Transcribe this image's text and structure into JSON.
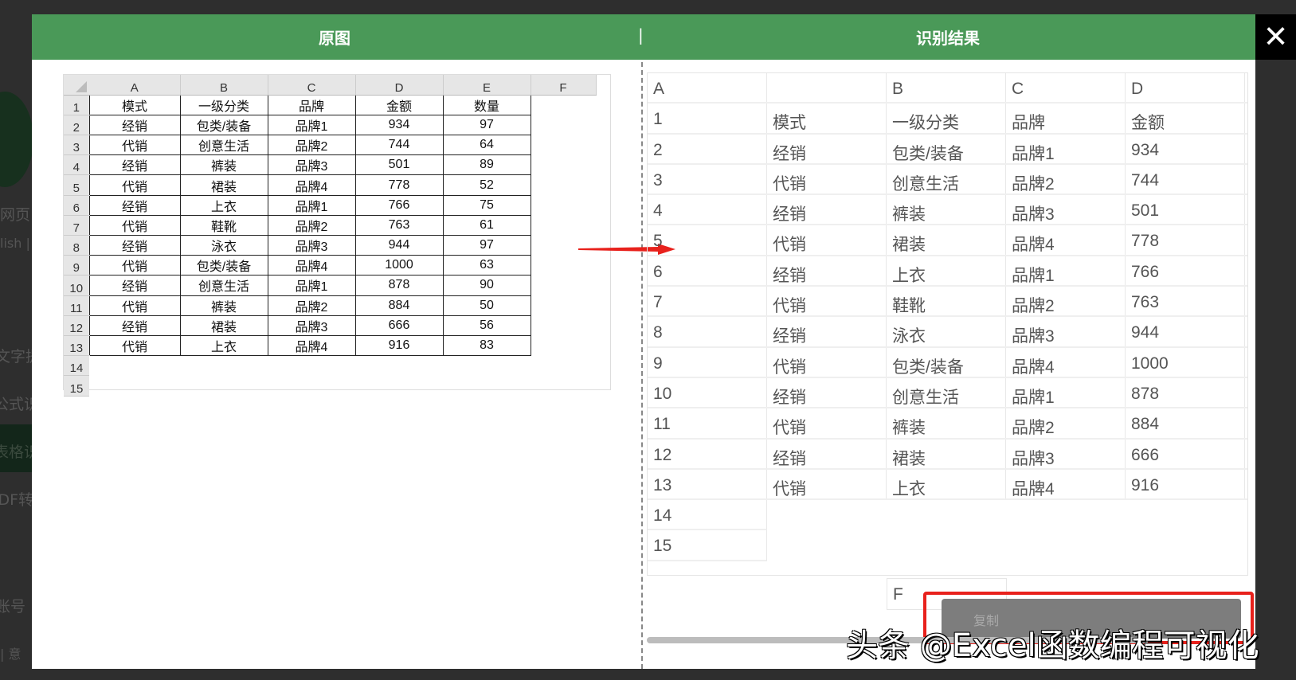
{
  "background": {
    "texts": [
      "网页",
      "lish |",
      "文字提",
      "公式识",
      "表格识",
      "PDF转",
      "账号",
      "| 意"
    ]
  },
  "modal": {
    "left_title": "原图",
    "separator": "|",
    "right_title": "识别结果",
    "close_icon": "close-x-icon"
  },
  "original": {
    "col_headers": [
      "A",
      "B",
      "C",
      "D",
      "E",
      "F"
    ],
    "row_numbers": [
      "1",
      "2",
      "3",
      "4",
      "5",
      "6",
      "7",
      "8",
      "9",
      "10",
      "11",
      "12",
      "13",
      "14",
      "15"
    ],
    "rows": [
      [
        "模式",
        "一级分类",
        "品牌",
        "金额",
        "数量"
      ],
      [
        "经销",
        "包类/装备",
        "品牌1",
        "934",
        "97"
      ],
      [
        "代销",
        "创意生活",
        "品牌2",
        "744",
        "64"
      ],
      [
        "经销",
        "裤装",
        "品牌3",
        "501",
        "89"
      ],
      [
        "代销",
        "裙装",
        "品牌4",
        "778",
        "52"
      ],
      [
        "经销",
        "上衣",
        "品牌1",
        "766",
        "75"
      ],
      [
        "代销",
        "鞋靴",
        "品牌2",
        "763",
        "61"
      ],
      [
        "经销",
        "泳衣",
        "品牌3",
        "944",
        "97"
      ],
      [
        "代销",
        "包类/装备",
        "品牌4",
        "1000",
        "63"
      ],
      [
        "经销",
        "创意生活",
        "品牌1",
        "878",
        "90"
      ],
      [
        "代销",
        "裤装",
        "品牌2",
        "884",
        "50"
      ],
      [
        "经销",
        "裙装",
        "品牌3",
        "666",
        "56"
      ],
      [
        "代销",
        "上衣",
        "品牌4",
        "916",
        "83"
      ]
    ]
  },
  "result": {
    "col_headers": [
      "A",
      "",
      "B",
      "C",
      "D"
    ],
    "rows": [
      [
        "1",
        "模式",
        "一级分类",
        "品牌",
        "金额"
      ],
      [
        "2",
        "经销",
        "包类/装备",
        "品牌1",
        "934"
      ],
      [
        "3",
        "代销",
        "创意生活",
        "品牌2",
        "744"
      ],
      [
        "4",
        "经销",
        "裤装",
        "品牌3",
        "501"
      ],
      [
        "5",
        "代销",
        "裙装",
        "品牌4",
        "778"
      ],
      [
        "6",
        "经销",
        "上衣",
        "品牌1",
        "766"
      ],
      [
        "7",
        "代销",
        "鞋靴",
        "品牌2",
        "763"
      ],
      [
        "8",
        "经销",
        "泳衣",
        "品牌3",
        "944"
      ],
      [
        "9",
        "代销",
        "包类/装备",
        "品牌4",
        "1000"
      ],
      [
        "10",
        "经销",
        "创意生活",
        "品牌1",
        "878"
      ],
      [
        "11",
        "代销",
        "裤装",
        "品牌2",
        "884"
      ],
      [
        "12",
        "经销",
        "裙装",
        "品牌3",
        "666"
      ],
      [
        "13",
        "代销",
        "上衣",
        "品牌4",
        "916"
      ],
      [
        "14"
      ],
      [
        "15"
      ]
    ],
    "extra_header": "F",
    "copy_label": "复制"
  },
  "watermark": "头条 @Excel函数编程可视化",
  "colors": {
    "header_green": "#4a9958",
    "highlight_red": "#e8211c"
  }
}
